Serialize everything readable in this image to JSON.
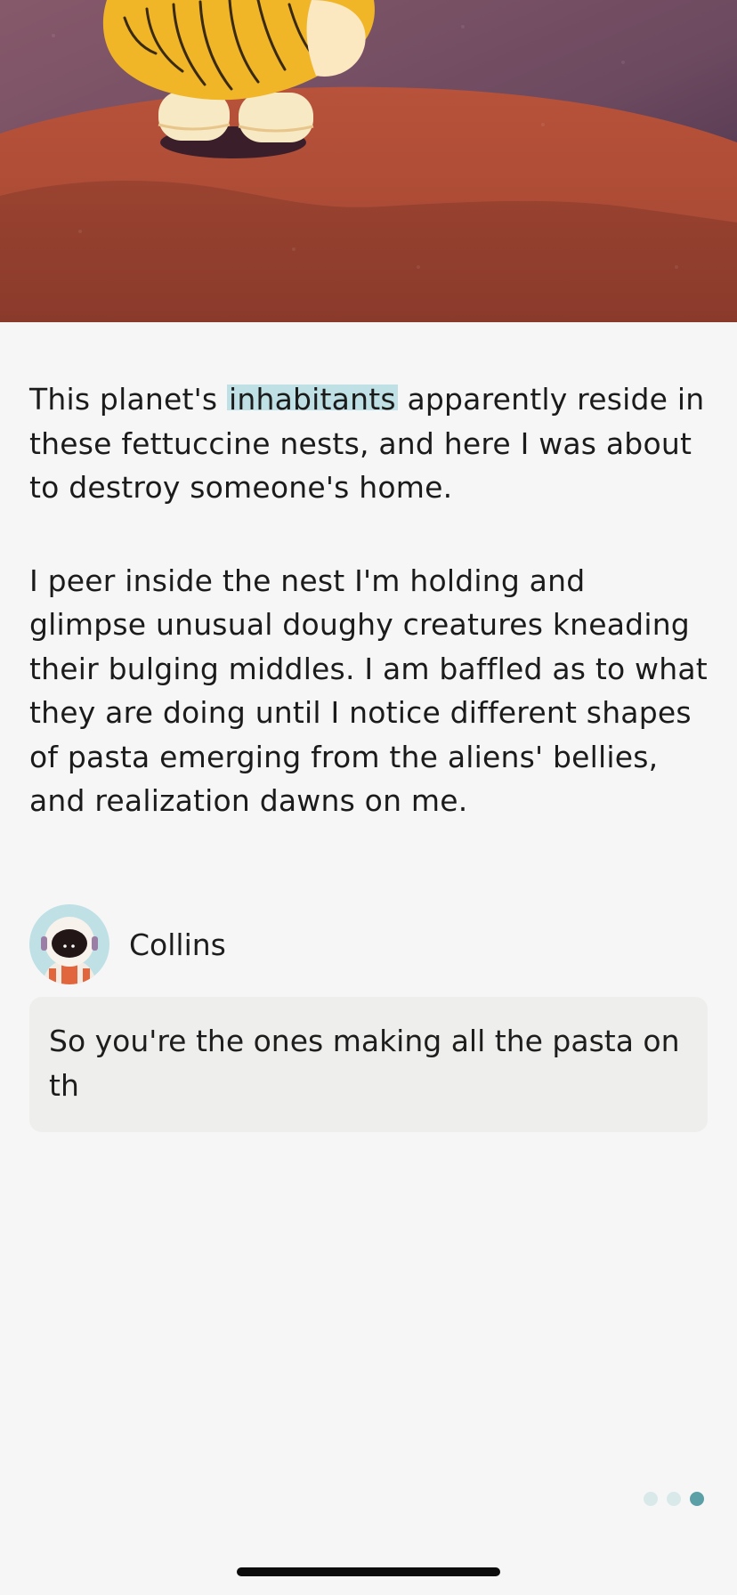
{
  "story": {
    "paragraph1": {
      "before": "This planet's",
      "highlight": "inhabitants",
      "after": "apparently reside in these fettuccine nests, and here I was about to destroy someone's home."
    },
    "paragraph2": "I peer inside the nest I'm holding and glimpse unusual doughy creatures kneading their bulging middles. I am baffled as to what they are doing until I notice different shapes of pasta emerging from the aliens' bellies, and realization dawns on me."
  },
  "speaker": {
    "name": "Collins",
    "avatar_icon": "astronaut-avatar-icon"
  },
  "reply": {
    "text": "So you're the ones making all the pasta on th"
  },
  "pager": {
    "total": 3,
    "active_index": 2,
    "active_color": "#5aa0a6",
    "inactive_color": "#d9e9ea"
  },
  "colors": {
    "highlight": "#bfe0e5",
    "background": "#f6f6f6",
    "reply_box": "#eeeeec"
  }
}
